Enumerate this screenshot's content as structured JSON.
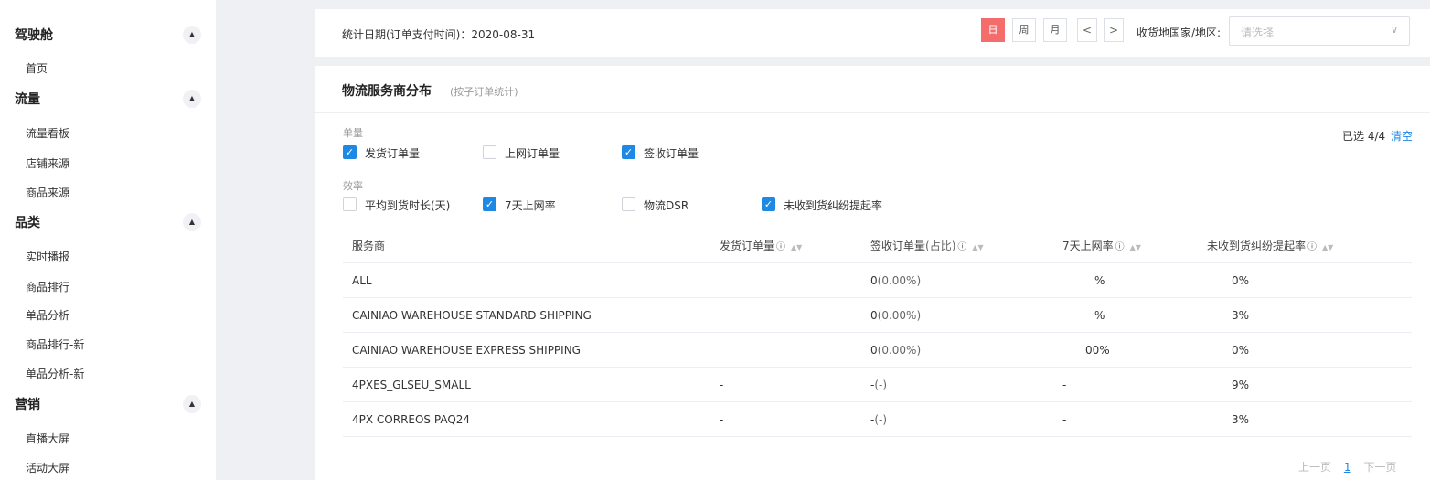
{
  "sidebar": {
    "groups": [
      {
        "title": "驾驶舱",
        "items": [
          "首页"
        ]
      },
      {
        "title": "流量",
        "items": [
          "流量看板",
          "店铺来源",
          "商品来源"
        ]
      },
      {
        "title": "品类",
        "items": [
          "实时播报",
          "商品排行",
          "单品分析",
          "商品排行-新",
          "单品分析-新"
        ]
      },
      {
        "title": "营销",
        "items": [
          "直播大屏",
          "活动大屏"
        ]
      }
    ],
    "toggle_glyph": "▲"
  },
  "filter": {
    "stat_date_label": "统计日期(订单支付时间)：2020-08-31",
    "periods": [
      "日",
      "周",
      "月"
    ],
    "prev_glyph": "<",
    "next_glyph": ">",
    "country_label": "收货地国家/地区:",
    "country_placeholder": "请选择"
  },
  "panel": {
    "title": "物流服务商分布",
    "subtitle": "(按子订单统计)",
    "selected_count": "已选 4/4",
    "clear_label": "清空",
    "groups": [
      {
        "label": "单量",
        "options": [
          {
            "label": "发货订单量",
            "checked": true
          },
          {
            "label": "上网订单量",
            "checked": false
          },
          {
            "label": "签收订单量",
            "checked": true
          }
        ]
      },
      {
        "label": "效率",
        "options": [
          {
            "label": "平均到货时长(天)",
            "checked": false
          },
          {
            "label": "7天上网率",
            "checked": true
          },
          {
            "label": "物流DSR",
            "checked": false
          },
          {
            "label": "未收到货纠纷提起率",
            "checked": true
          }
        ]
      }
    ]
  },
  "table": {
    "columns": [
      "服务商",
      "发货订单量",
      "签收订单量",
      "(占比)",
      "7天上网率",
      "未收到货纠纷提起率"
    ],
    "rows": [
      {
        "provider": "ALL",
        "shipped": "",
        "signed": "0",
        "signed_pct": "(0.00%)",
        "rate7d": "%",
        "dispute": "0%"
      },
      {
        "provider": "CAINIAO WAREHOUSE STANDARD SHIPPING",
        "shipped": "",
        "signed": "0",
        "signed_pct": "(0.00%)",
        "rate7d": "%",
        "dispute": "3%"
      },
      {
        "provider": "CAINIAO WAREHOUSE EXPRESS SHIPPING",
        "shipped": "",
        "signed": "0",
        "signed_pct": "(0.00%)",
        "rate7d": "00%",
        "dispute": "0%"
      },
      {
        "provider": "4PXES_GLSEU_SMALL",
        "shipped": "-",
        "signed": "-",
        "signed_pct": "(-)",
        "rate7d": "-",
        "dispute": "9%"
      },
      {
        "provider": "4PX CORREOS PAQ24",
        "shipped": "-",
        "signed": "-",
        "signed_pct": "(-)",
        "rate7d": "-",
        "dispute": "3%"
      }
    ]
  },
  "pager": {
    "prev": "上一页",
    "current": "1",
    "next": "下一页"
  }
}
